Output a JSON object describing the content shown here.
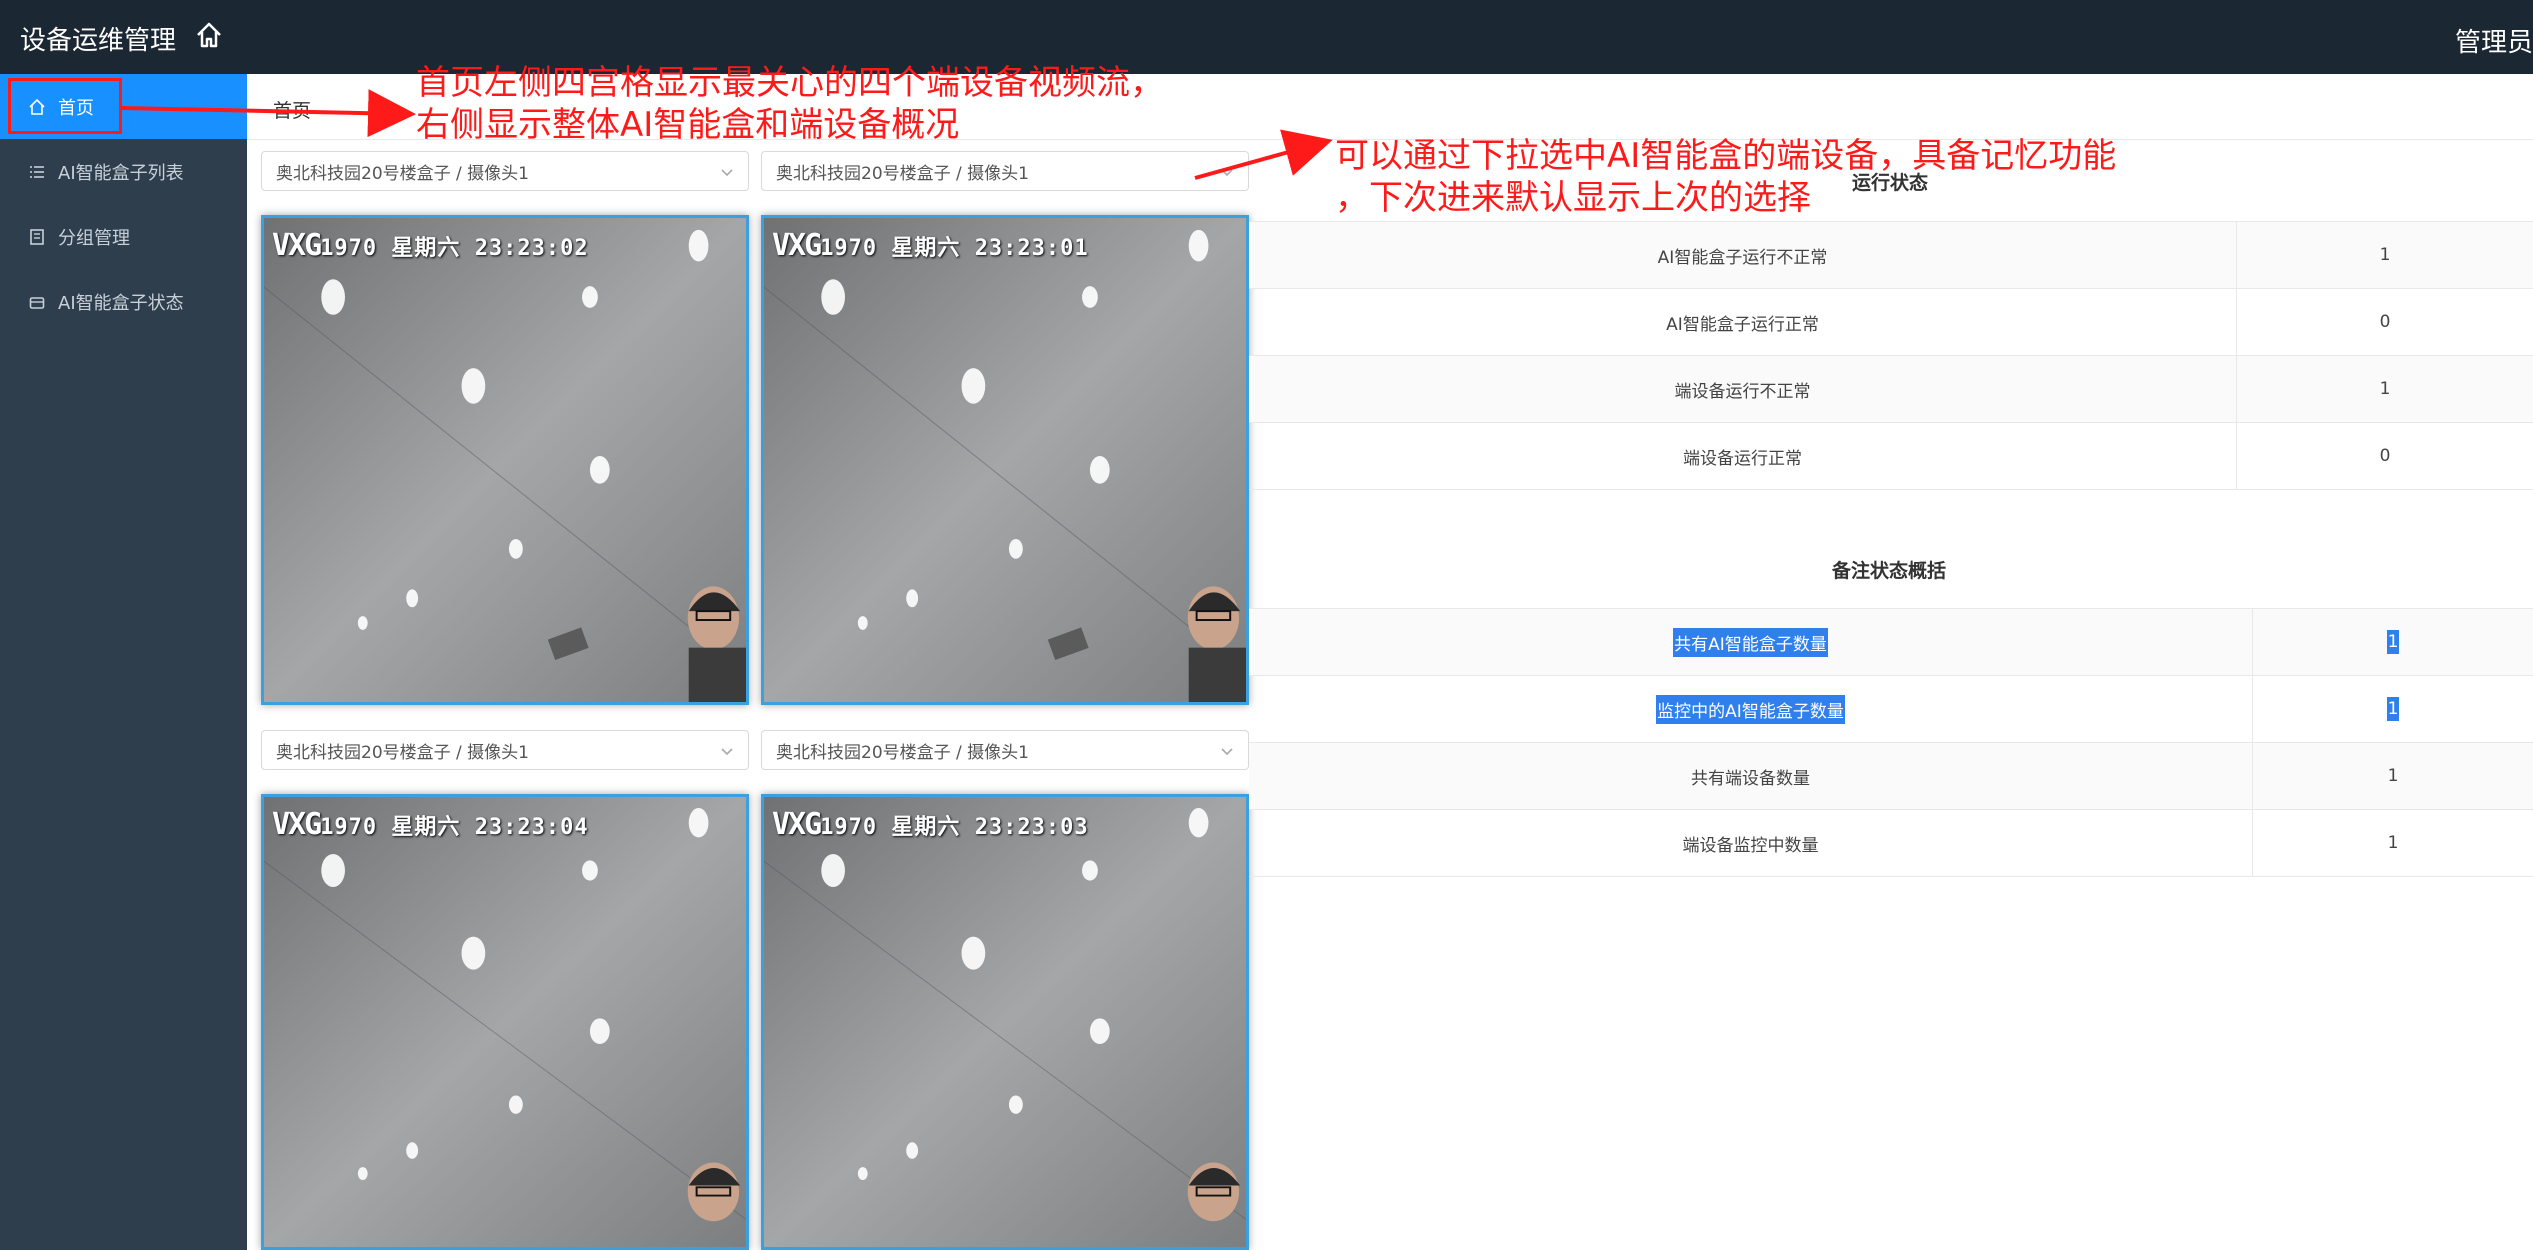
{
  "header": {
    "app_title": "设备运维管理",
    "home_icon": "home-icon",
    "user_label": "管理员"
  },
  "sidebar": {
    "items": [
      {
        "label": "首页",
        "icon": "home-icon",
        "active": true
      },
      {
        "label": "AI智能盒子列表",
        "icon": "list-icon",
        "active": false
      },
      {
        "label": "分组管理",
        "icon": "book-icon",
        "active": false
      },
      {
        "label": "AI智能盒子状态",
        "icon": "box-icon",
        "active": false
      }
    ]
  },
  "breadcrumb": {
    "current": "首页"
  },
  "video_grid": {
    "selects": [
      {
        "value": "奥北科技园20号楼盒子 / 摄像头1"
      },
      {
        "value": "奥北科技园20号楼盒子 / 摄像头1"
      },
      {
        "value": "奥北科技园20号楼盒子 / 摄像头1"
      },
      {
        "value": "奥北科技园20号楼盒子 / 摄像头1"
      }
    ],
    "videos": [
      {
        "logo": "VXG",
        "year": "1970",
        "weekday": "星期六",
        "time": "23:23:02"
      },
      {
        "logo": "VXG",
        "year": "1970",
        "weekday": "星期六",
        "time": "23:23:01"
      },
      {
        "logo": "VXG",
        "year": "1970",
        "weekday": "星期六",
        "time": "23:23:04"
      },
      {
        "logo": "VXG",
        "year": "1970",
        "weekday": "星期六",
        "time": "23:23:03"
      }
    ]
  },
  "run_status": {
    "title": "运行状态",
    "rows": [
      {
        "label": "AI智能盒子运行不正常",
        "value": "1"
      },
      {
        "label": "AI智能盒子运行正常",
        "value": "0"
      },
      {
        "label": "端设备运行不正常",
        "value": "1"
      },
      {
        "label": "端设备运行正常",
        "value": "0"
      }
    ]
  },
  "summary": {
    "title": "备注状态概括",
    "rows": [
      {
        "label": "共有AI智能盒子数量",
        "value": "1",
        "selected": true
      },
      {
        "label": "监控中的AI智能盒子数量",
        "value": "1",
        "selected": true
      },
      {
        "label": "共有端设备数量",
        "value": "1",
        "selected": false
      },
      {
        "label": "端设备监控中数量",
        "value": "1",
        "selected": false
      }
    ]
  },
  "annotations": {
    "left_line1": "首页左侧四宫格显示最关心的四个端设备视频流，",
    "left_line2": "右侧显示整体AI智能盒和端设备概况",
    "right_line1": "可以通过下拉选中AI智能盒的端设备，具备记忆功能",
    "right_line2": "，下次进来默认显示上次的选择",
    "color": "#ff1a1a"
  },
  "colors": {
    "topbar": "#1b2733",
    "sidebar": "#2f3e4d",
    "active": "#1890ff",
    "selection": "#2f80ed"
  }
}
